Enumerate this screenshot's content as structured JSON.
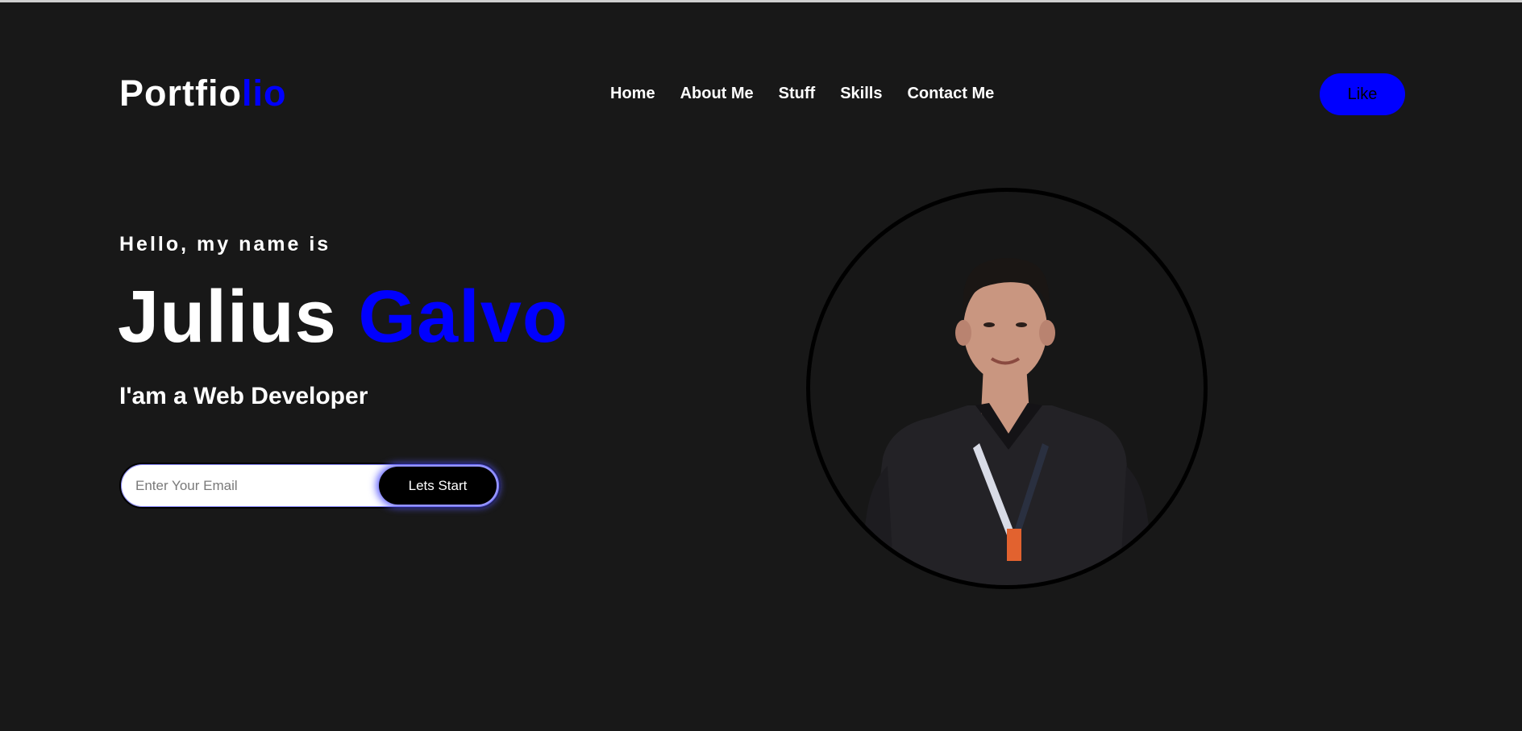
{
  "header": {
    "logo_main": "Portfio",
    "logo_accent": "lio",
    "nav": [
      "Home",
      "About Me",
      "Stuff",
      "Skills",
      "Contact Me"
    ],
    "like_label": "Like"
  },
  "hero": {
    "greeting": "Hello, my name is",
    "first_name": "Julius",
    "last_name": "Galvo",
    "role": "I'am a Web Developer",
    "email_placeholder": "Enter Your Email",
    "start_label": "Lets Start"
  },
  "colors": {
    "background": "#181818",
    "accent": "#0000ff",
    "text": "#ffffff"
  },
  "icons": [
    "person-portrait"
  ]
}
